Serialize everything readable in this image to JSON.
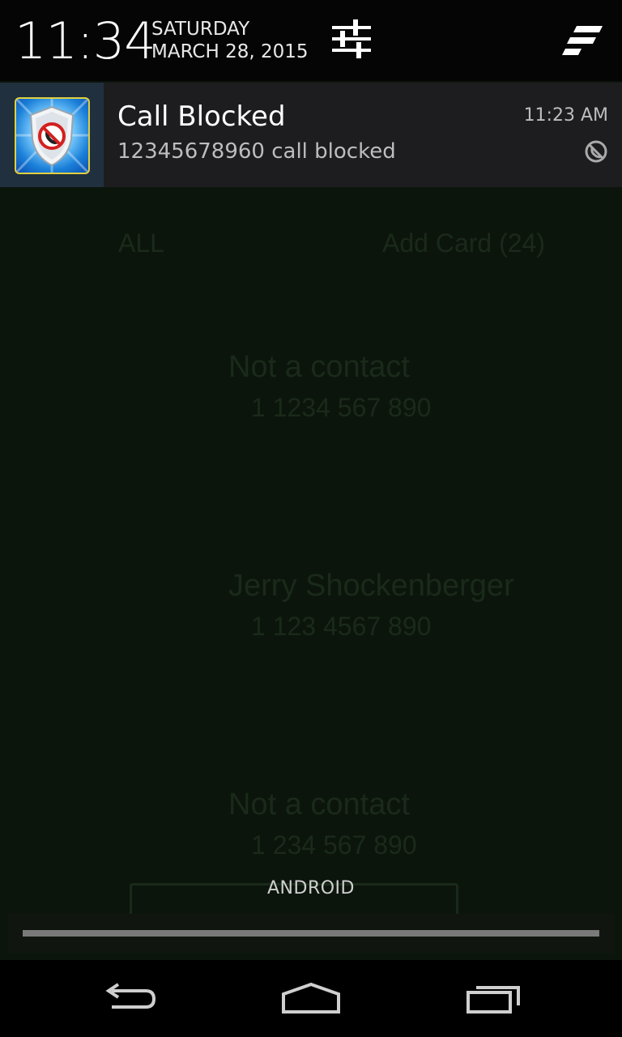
{
  "header": {
    "time": "11:34",
    "day": "SATURDAY",
    "date": "MARCH 28, 2015",
    "settings_icon": "quick-settings-sliders-icon",
    "clear_icon": "clear-all-notifications-icon"
  },
  "notification": {
    "title": "Call Blocked",
    "text": "12345678960 call blocked",
    "time": "11:23 AM",
    "app_icon": "call-blocker-shield-icon",
    "small_icon": "block-icon"
  },
  "background_app": {
    "tab_left": "ALL",
    "tab_right": "Add Card (24)",
    "entries": [
      {
        "name": "Not a contact",
        "number": "1 1234 567 890"
      },
      {
        "name": "Jerry Shockenberger",
        "number": "1 123 4567 890"
      },
      {
        "name": "Not a contact",
        "number": "1 234 567 890"
      }
    ]
  },
  "carrier": "ANDROID",
  "navbar": {
    "back_icon": "back-icon",
    "home_icon": "home-icon",
    "recents_icon": "recents-icon"
  },
  "colors": {
    "header_bg": "#050505",
    "notification_bg": "#1d1d1f",
    "icon_box_bg": "#20303e",
    "shield_blue": "#1a7fd8"
  }
}
